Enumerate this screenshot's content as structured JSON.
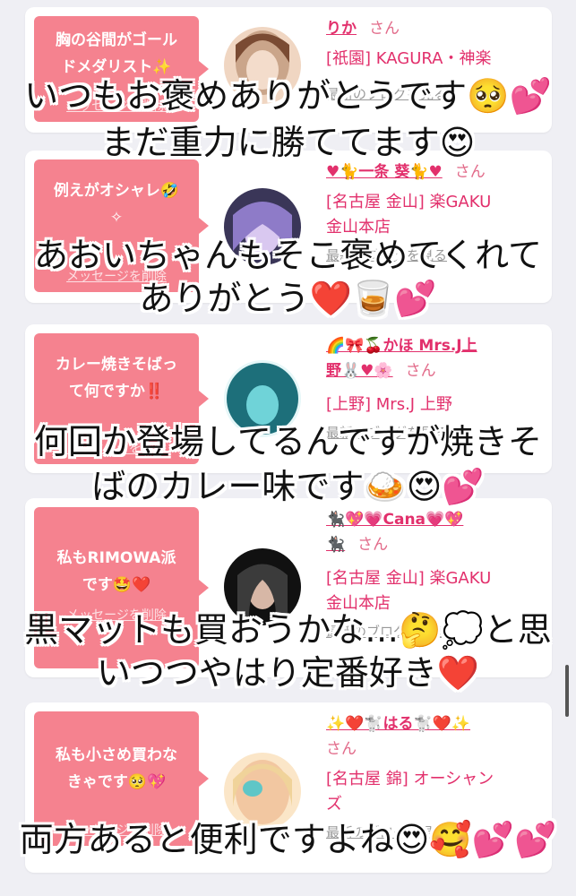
{
  "cards": [
    {
      "message": "胸の谷間がゴール\nドメダリスト✨",
      "delete_label": "メッセージを削除",
      "name": "りか",
      "san": "さん",
      "shop": "[祇園] KAGURA・神楽",
      "blog_link": "最新のブログを見る",
      "avatar_colors": [
        "#caa58a",
        "#7a4b33",
        "#f0d6c2"
      ]
    },
    {
      "message": "例えがオシャレ🤣\n✧",
      "delete_label": "メッセージを削除",
      "name": "♥🐈一条 葵🐈♥",
      "san": "さん",
      "shop": "[名古屋 金山] 楽GAKU\n金山本店",
      "blog_link": "最新のブログを見る",
      "avatar_colors": [
        "#3a3658",
        "#8e7bc8",
        "#d9c8f0"
      ]
    },
    {
      "message": "カレー焼きそばっ\nて何ですか‼️",
      "delete_label": "メッセージを削除",
      "name": "🌈🎀🍒かほ Mrs.J上\n野🐰♥🌸",
      "san": "さん",
      "shop": "[上野] Mrs.J 上野",
      "blog_link": "最新のブログを見る",
      "avatar_colors": [
        "#1d6f7a",
        "#6fd3d8",
        "#e6f7f8"
      ]
    },
    {
      "message": "私もRIMOWA派\nです🤩❤️",
      "delete_label": "メッセージを削除",
      "name": "🐈‍⬛💖💗Cana💗💖\n🐈‍⬛",
      "san": "さん",
      "shop": "[名古屋 金山] 楽GAKU\n金山本店",
      "blog_link": "最新のブログを見る",
      "avatar_colors": [
        "#111111",
        "#3b3b3b",
        "#d7b7a6"
      ]
    },
    {
      "message": "私も小さめ買わな\nきゃです🥺💖",
      "delete_label": "メッセージを削除",
      "name": "✨❤️🐩はる🐩❤️✨",
      "san": "さん",
      "shop": "[名古屋 錦] オーシャン\nズ",
      "blog_link": "最新のブログを見る",
      "avatar_colors": [
        "#f2c7a1",
        "#5fc6c7",
        "#fbe6c8"
      ]
    }
  ],
  "captions": [
    "いつもお褒めありがとうです🥺💕",
    "まだ重力に勝ててます😍",
    "あおいちゃんもそこ褒めてくれて",
    "ありがとう❤️🥃💕",
    "何回か登場してるんですが焼きそ",
    "ばのカレー味です🍛😍💕",
    "黒マットも買おうかな…🤔💭と思",
    "いつつやはり定番好き❤️",
    "両方あると便利ですよね😍🥰💕💕"
  ]
}
